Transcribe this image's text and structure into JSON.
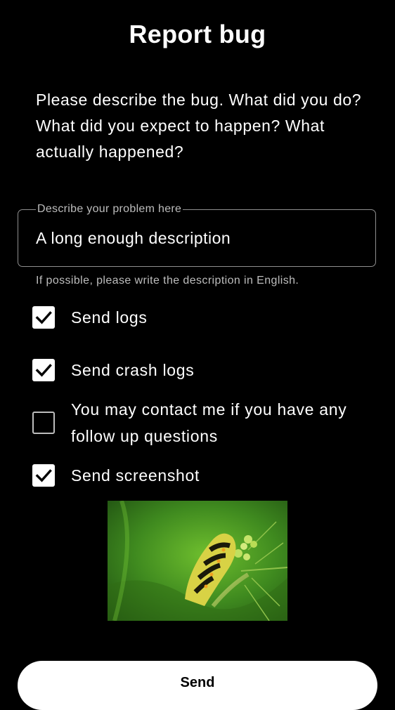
{
  "header": {
    "title": "Report bug"
  },
  "instructions": "Please describe the bug. What did you do? What did you expect to happen? What actually happened?",
  "description_field": {
    "label": "Describe your problem here",
    "value": "A long enough description",
    "helper": "If possible, please write the description in English."
  },
  "options": [
    {
      "label": "Send logs",
      "checked": true
    },
    {
      "label": "Send crash logs",
      "checked": true
    },
    {
      "label": "You may contact me if you have any follow up questions",
      "checked": false
    },
    {
      "label": "Send screenshot",
      "checked": true
    }
  ],
  "screenshot_preview": {
    "subject": "caterpillar-on-plant"
  },
  "send_button": {
    "label": "Send"
  },
  "colors": {
    "background": "#000000",
    "text": "#ffffff",
    "secondary_text": "#bdbdbd",
    "button_bg": "#ffffff",
    "button_text": "#000000"
  }
}
